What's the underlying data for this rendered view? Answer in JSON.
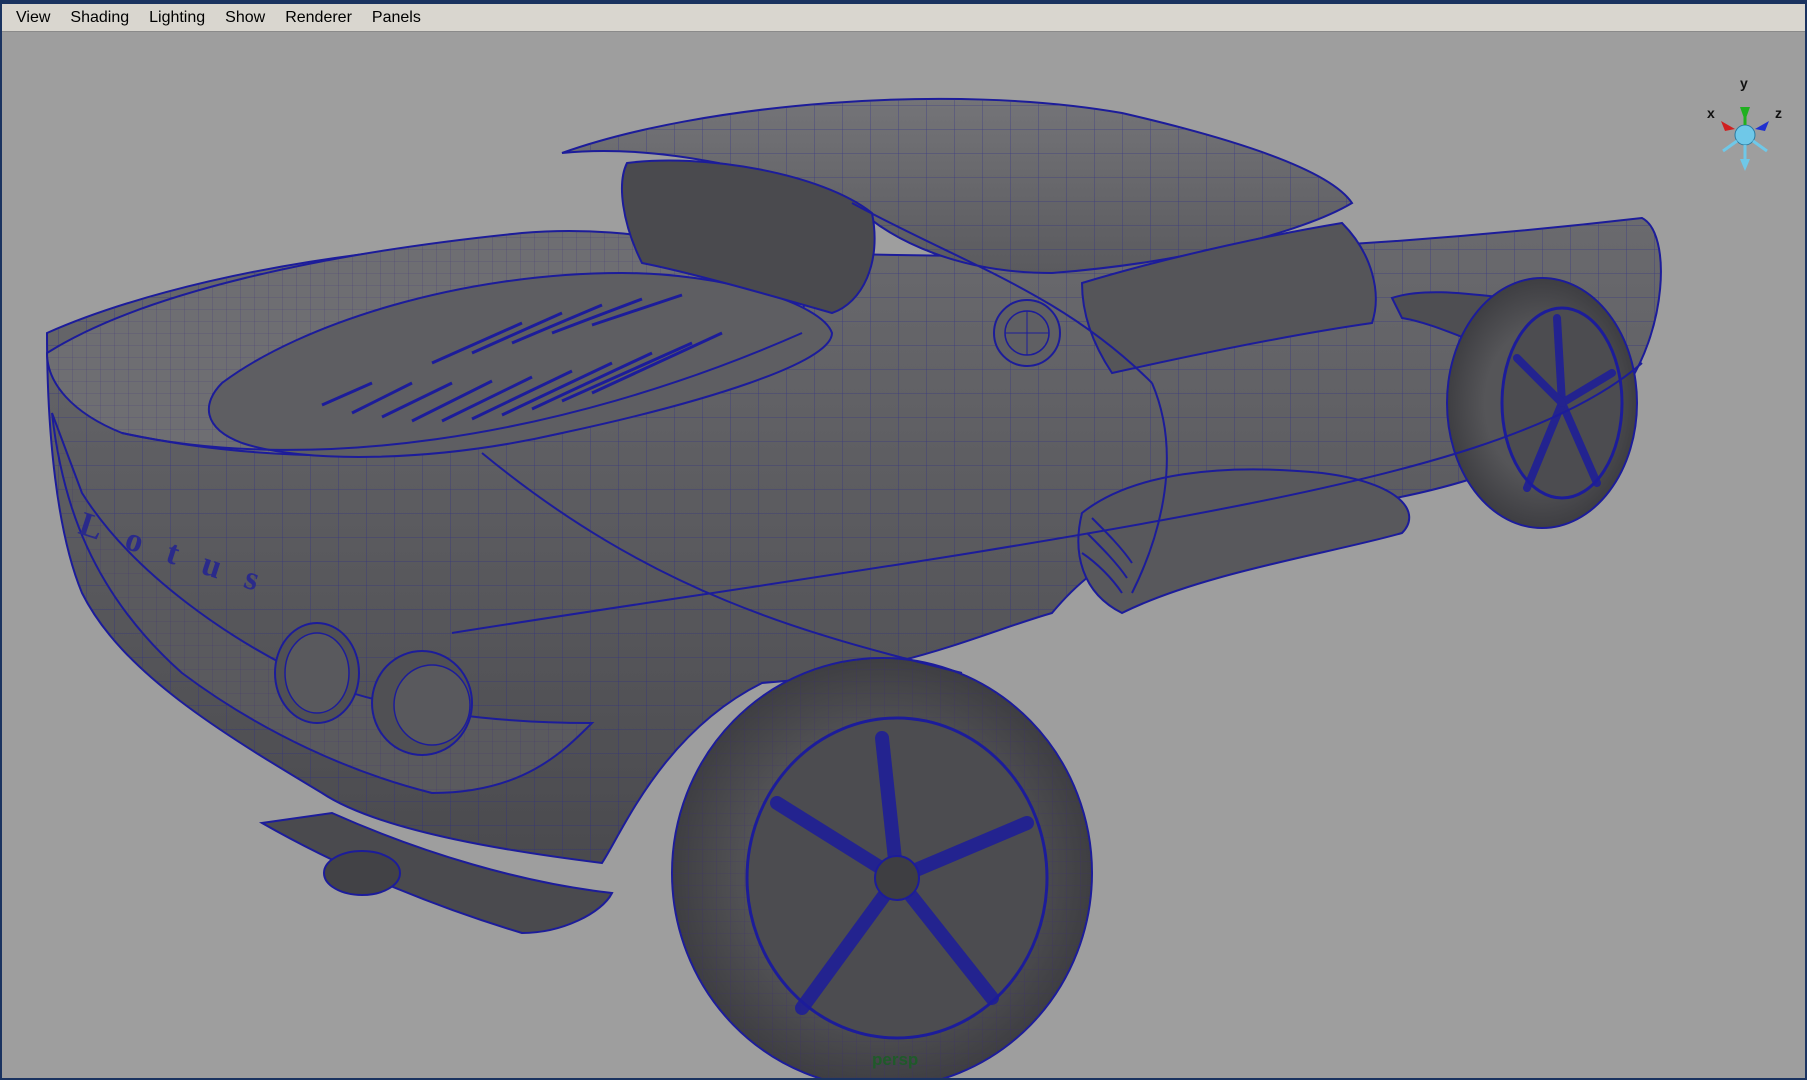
{
  "menu": {
    "items": [
      "View",
      "Shading",
      "Lighting",
      "Show",
      "Renderer",
      "Panels"
    ]
  },
  "viewport": {
    "camera": "persp",
    "logo_text": "Lotus"
  },
  "axis": {
    "x": "x",
    "y": "y",
    "z": "z"
  },
  "colors": {
    "background": "#9e9e9e",
    "wireframe": "#1c1c9a",
    "menubar": "#d9d6cf",
    "border": "#1a3360",
    "camera_label": "#1f5a2a",
    "axis_x": "#d02020",
    "axis_y": "#20b020",
    "axis_z": "#2030d0",
    "axis_center": "#6fc8e8"
  }
}
